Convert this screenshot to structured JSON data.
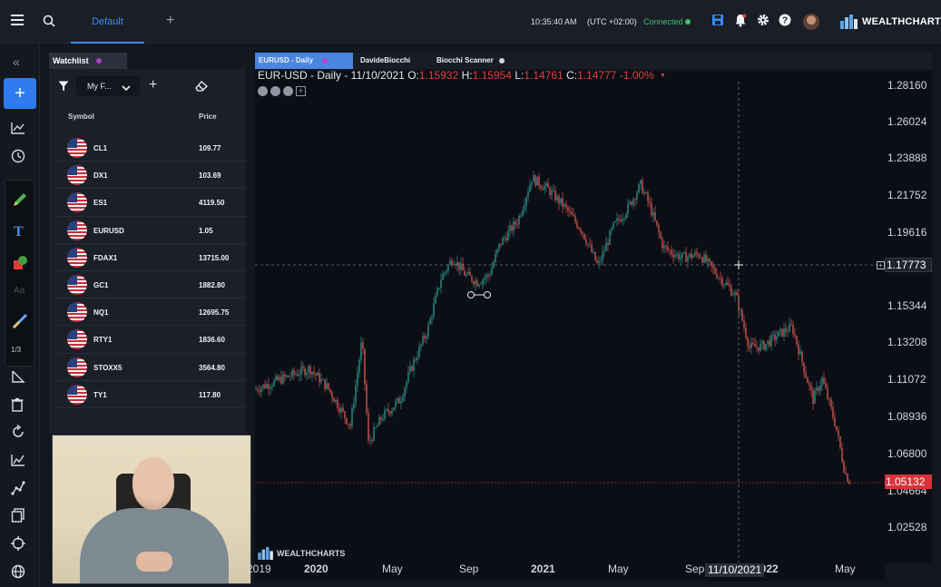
{
  "header": {
    "tab_default": "Default",
    "time": "10:35:40 AM",
    "timezone": "(UTC +02:00)",
    "connection_status": "Connected",
    "brand": "WEALTHCHARTS",
    "accent": "#3d8bfd"
  },
  "left_rail": {
    "toolbox_counter": "1/3",
    "icons": [
      "collapse-icon",
      "add-icon",
      "line-chart-icon",
      "clock-icon",
      "pencil-icon",
      "text-tool-icon",
      "shape-tool-icon",
      "magnifier-tool-icon",
      "measure-icon",
      "trash-icon",
      "refresh-icon",
      "indicator-icon",
      "node-icon",
      "copy-icon",
      "crosshair-icon",
      "globe-icon"
    ]
  },
  "watchlist": {
    "tab_label": "Watchlist",
    "list_select": "My F...",
    "col_symbol": "Symbol",
    "col_price": "Price",
    "rows": [
      {
        "symbol": "CL1",
        "price": "109.77"
      },
      {
        "symbol": "DX1",
        "price": "103.69"
      },
      {
        "symbol": "ES1",
        "price": "4119.50"
      },
      {
        "symbol": "EURUSD",
        "price": "1.05"
      },
      {
        "symbol": "FDAX1",
        "price": "13715.00"
      },
      {
        "symbol": "GC1",
        "price": "1882.80"
      },
      {
        "symbol": "NQ1",
        "price": "12695.75"
      },
      {
        "symbol": "RTY1",
        "price": "1836.60"
      },
      {
        "symbol": "STOXX5",
        "price": "3564.80"
      },
      {
        "symbol": "TY1",
        "price": "117.80"
      }
    ]
  },
  "chart_tabs": [
    {
      "label": "EURUSD - Daily"
    },
    {
      "label": "DavideBiocchi"
    },
    {
      "label": "Biocchi Scanner"
    }
  ],
  "legend": {
    "title": "EUR-USD - Daily - 11/10/2021",
    "o_label": "O:",
    "o_value": "1.15932",
    "h_label": "H:",
    "h_value": "1.15954",
    "l_label": "L:",
    "l_value": "1.14761",
    "c_label": "C:",
    "c_value": "1.14777",
    "change": "-1.00%"
  },
  "price_axis": {
    "labels": [
      "1.28160",
      "1.26024",
      "1.23888",
      "1.21752",
      "1.19616",
      "1.15344",
      "1.13208",
      "1.11072",
      "1.08936",
      "1.06800",
      "1.04664",
      "1.02528"
    ],
    "crosshair_value": "1.17773",
    "last_price": "1.05132",
    "last_price_color": "#d8333b"
  },
  "time_axis": {
    "labels": [
      {
        "text": "2019",
        "bold": false
      },
      {
        "text": "2020",
        "bold": true
      },
      {
        "text": "May",
        "bold": false
      },
      {
        "text": "Sep",
        "bold": false
      },
      {
        "text": "2021",
        "bold": true
      },
      {
        "text": "May",
        "bold": false
      },
      {
        "text": "Sep",
        "bold": false
      },
      {
        "text": "2022",
        "bold": true
      },
      {
        "text": "May",
        "bold": false
      }
    ],
    "crosshair_date": "11/10/2021"
  },
  "watermark": "WEALTHCHARTS",
  "colors": {
    "up": "#2f8f8a",
    "down": "#d0554f"
  }
}
